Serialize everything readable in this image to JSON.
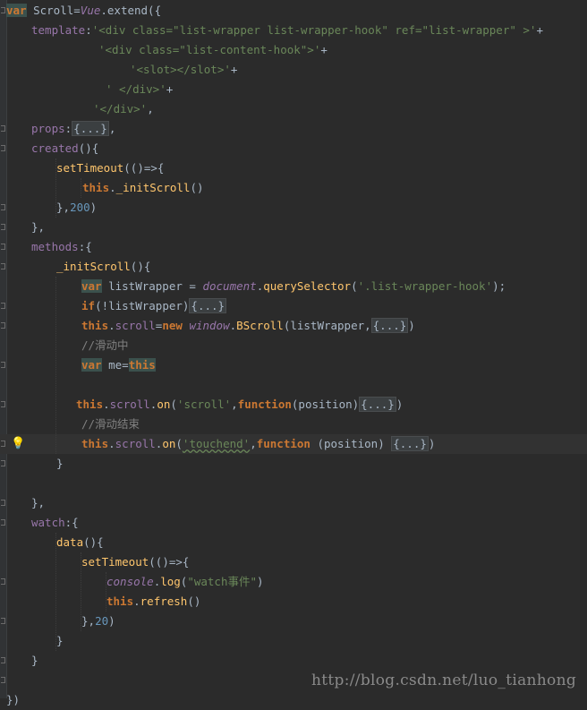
{
  "editor": {
    "lines": [
      {
        "segments": [
          [
            "kw hl",
            "var"
          ],
          [
            "plain",
            " Scroll="
          ],
          [
            "glob",
            "Vue"
          ],
          [
            "plain",
            ".extend({"
          ]
        ]
      },
      {
        "segments": [
          [
            "prop",
            "template"
          ],
          [
            "plain",
            ":"
          ],
          [
            "str",
            "'<div class=\"list-wrapper list-wrapper-hook\" ref=\"list-wrapper\" >'"
          ],
          [
            "plain",
            "+"
          ]
        ]
      },
      {
        "segments": [
          [
            "str",
            "'<div class=\"list-content-hook\">'"
          ],
          [
            "plain",
            "+"
          ]
        ]
      },
      {
        "segments": [
          [
            "str",
            "'<slot></slot>'"
          ],
          [
            "plain",
            "+"
          ]
        ]
      },
      {
        "segments": [
          [
            "str",
            "' </div>'"
          ],
          [
            "plain",
            "+"
          ]
        ]
      },
      {
        "segments": [
          [
            "str",
            "'</div>'"
          ],
          [
            "plain",
            ","
          ]
        ]
      },
      {
        "segments": [
          [
            "prop",
            "props"
          ],
          [
            "plain",
            ":"
          ],
          [
            "collapsed",
            "{...}"
          ],
          [
            "plain",
            ","
          ]
        ]
      },
      {
        "segments": [
          [
            "prop",
            "created"
          ],
          [
            "plain",
            "(){"
          ]
        ]
      },
      {
        "segments": [
          [
            "fn",
            "setTimeout"
          ],
          [
            "plain",
            "(()=>{"
          ]
        ]
      },
      {
        "segments": [
          [
            "kw",
            "this"
          ],
          [
            "plain",
            "."
          ],
          [
            "fn",
            "_initScroll"
          ],
          [
            "plain",
            "()"
          ]
        ]
      },
      {
        "segments": [
          [
            "plain",
            "},"
          ],
          [
            "num",
            "200"
          ],
          [
            "plain",
            ")"
          ]
        ]
      },
      {
        "segments": [
          [
            "plain",
            "},"
          ]
        ]
      },
      {
        "segments": [
          [
            "prop",
            "methods"
          ],
          [
            "plain",
            ":{"
          ]
        ]
      },
      {
        "segments": [
          [
            "fn",
            "_initScroll"
          ],
          [
            "plain",
            "(){"
          ]
        ]
      },
      {
        "segments": [
          [
            "kw hl",
            "var"
          ],
          [
            "plain",
            " listWrapper = "
          ],
          [
            "glob",
            "document"
          ],
          [
            "plain",
            "."
          ],
          [
            "fn",
            "querySelector"
          ],
          [
            "plain",
            "("
          ],
          [
            "str",
            "'.list-wrapper-hook'"
          ],
          [
            "plain",
            ");"
          ]
        ]
      },
      {
        "segments": [
          [
            "kw",
            "if"
          ],
          [
            "plain",
            "(!listWrapper)"
          ],
          [
            "collapsed",
            "{...}"
          ]
        ]
      },
      {
        "segments": [
          [
            "kw",
            "this"
          ],
          [
            "plain",
            "."
          ],
          [
            "prop",
            "scroll"
          ],
          [
            "plain",
            "="
          ],
          [
            "kw",
            "new"
          ],
          [
            "plain",
            " "
          ],
          [
            "glob",
            "window"
          ],
          [
            "plain",
            "."
          ],
          [
            "fn",
            "BScroll"
          ],
          [
            "plain",
            "(listWrapper,"
          ],
          [
            "collapsed",
            "{...}"
          ],
          [
            "plain",
            ")"
          ]
        ]
      },
      {
        "segments": [
          [
            "cmt",
            "//滑动中"
          ]
        ]
      },
      {
        "segments": [
          [
            "kw hl",
            "var"
          ],
          [
            "plain",
            " me="
          ],
          [
            "kw hl",
            "this"
          ]
        ]
      },
      {
        "segments": []
      },
      {
        "segments": [
          [
            "kw",
            "this"
          ],
          [
            "plain",
            "."
          ],
          [
            "prop",
            "scroll"
          ],
          [
            "plain",
            "."
          ],
          [
            "fn",
            "on"
          ],
          [
            "plain",
            "("
          ],
          [
            "str",
            "'scroll'"
          ],
          [
            "plain",
            ","
          ],
          [
            "kw",
            "function"
          ],
          [
            "plain",
            "(position)"
          ],
          [
            "collapsed",
            "{...}"
          ],
          [
            "plain",
            ")"
          ]
        ]
      },
      {
        "segments": [
          [
            "cmt",
            "//滑动结束"
          ]
        ]
      },
      {
        "segments": [
          [
            "kw",
            "this"
          ],
          [
            "plain",
            "."
          ],
          [
            "prop",
            "scroll"
          ],
          [
            "plain",
            "."
          ],
          [
            "fn",
            "on"
          ],
          [
            "plain",
            "("
          ],
          [
            "str squig",
            "'touchend'"
          ],
          [
            "plain",
            ","
          ],
          [
            "kw",
            "function"
          ],
          [
            "plain",
            " (position) "
          ],
          [
            "collapsed",
            "{...}"
          ],
          [
            "plain",
            ")"
          ]
        ]
      },
      {
        "segments": [
          [
            "plain",
            "}"
          ]
        ]
      },
      {
        "segments": []
      },
      {
        "segments": [
          [
            "plain",
            "},"
          ]
        ]
      },
      {
        "segments": [
          [
            "prop",
            "watch"
          ],
          [
            "plain",
            ":{"
          ]
        ]
      },
      {
        "segments": [
          [
            "fn",
            "data"
          ],
          [
            "plain",
            "(){"
          ]
        ]
      },
      {
        "segments": [
          [
            "fn",
            "setTimeout"
          ],
          [
            "plain",
            "(()=>{"
          ]
        ]
      },
      {
        "segments": [
          [
            "glob",
            "console"
          ],
          [
            "plain",
            "."
          ],
          [
            "fn",
            "log"
          ],
          [
            "plain",
            "("
          ],
          [
            "str",
            "\"watch事件\""
          ],
          [
            "plain",
            ")"
          ]
        ]
      },
      {
        "segments": [
          [
            "kw",
            "this"
          ],
          [
            "plain",
            "."
          ],
          [
            "fn",
            "refresh"
          ],
          [
            "plain",
            "()"
          ]
        ]
      },
      {
        "segments": [
          [
            "plain",
            "},"
          ],
          [
            "num",
            "20"
          ],
          [
            "plain",
            ")"
          ]
        ]
      },
      {
        "segments": [
          [
            "plain",
            "}"
          ]
        ]
      },
      {
        "segments": [
          [
            "plain",
            "}"
          ]
        ]
      },
      {
        "segments": []
      },
      {
        "segments": [
          [
            "plain",
            "})"
          ]
        ]
      }
    ]
  },
  "watermark": "http://blog.csdn.net/luo_tianhong",
  "icons": {
    "intention_bulb": "lightbulb-icon",
    "fold_marker": "fold-icon"
  },
  "colors": {
    "background": "#2b2b2b",
    "keyword": "#cc7832",
    "string": "#6a8759",
    "number": "#6897bb",
    "function": "#ffc66d",
    "property": "#9876aa",
    "comment": "#808080",
    "text": "#a9b7c6"
  }
}
